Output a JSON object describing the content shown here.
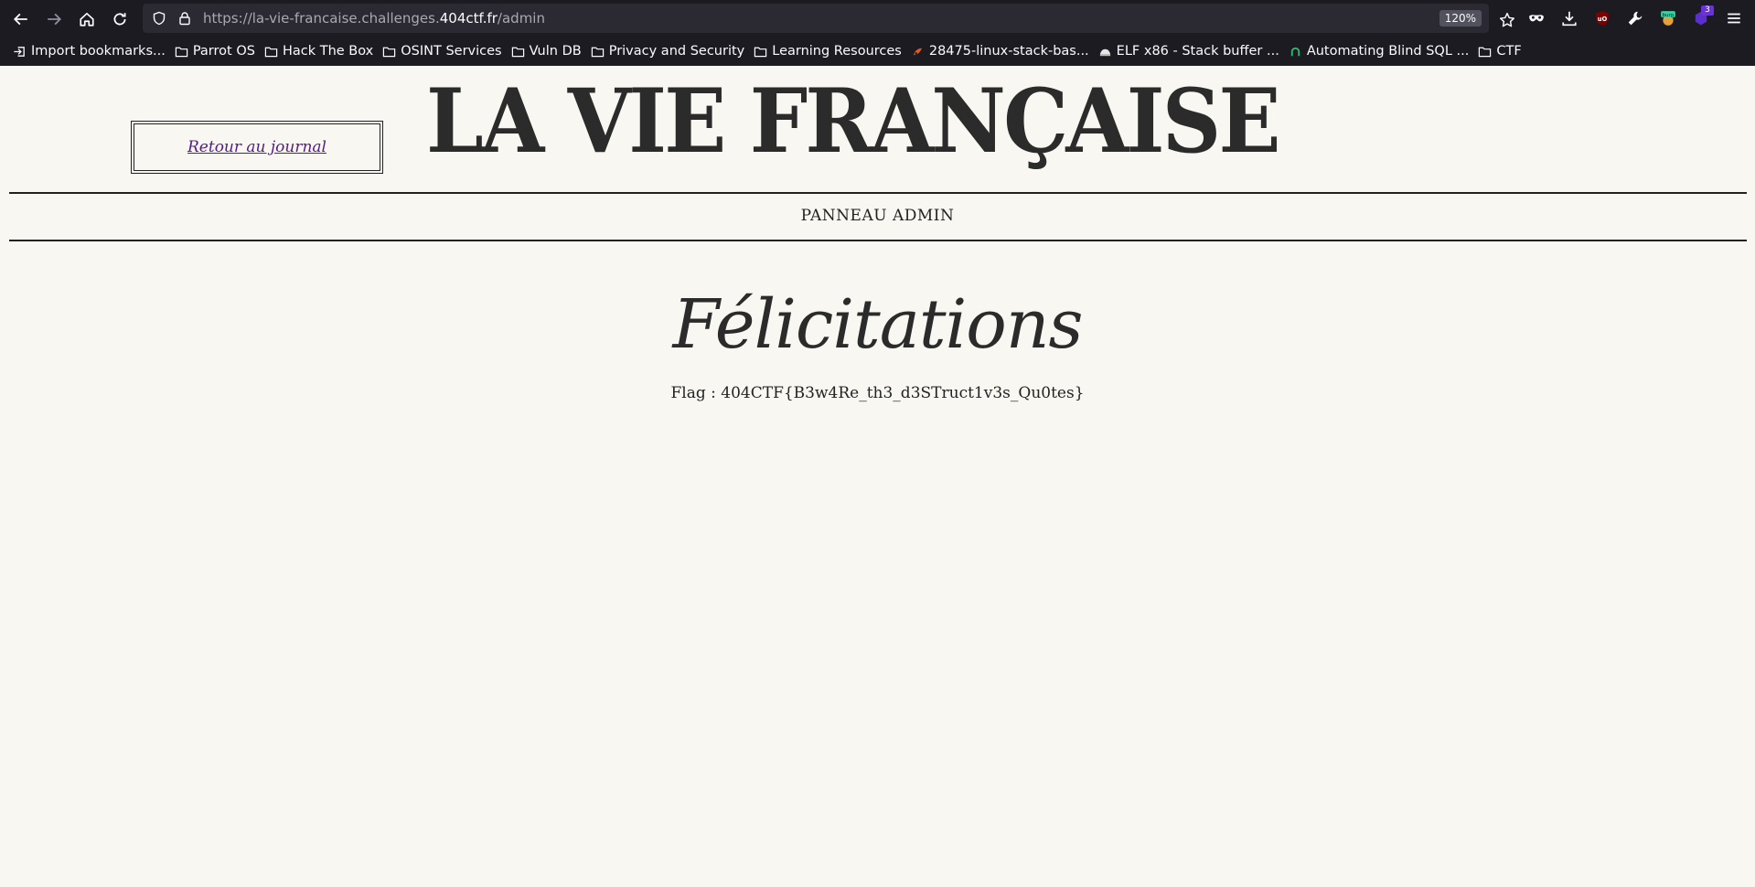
{
  "browser": {
    "url_prefix": "https://la-vie-francaise.challenges.",
    "url_host": "404ctf.fr",
    "url_path": "/admin",
    "zoom": "120%",
    "extension_badge": "3",
    "bookmarks": [
      {
        "label": "Import bookmarks...",
        "icon": "import-icon"
      },
      {
        "label": "Parrot OS",
        "icon": "folder-icon"
      },
      {
        "label": "Hack The Box",
        "icon": "folder-icon"
      },
      {
        "label": "OSINT Services",
        "icon": "folder-icon"
      },
      {
        "label": "Vuln DB",
        "icon": "folder-icon"
      },
      {
        "label": "Privacy and Security",
        "icon": "folder-icon"
      },
      {
        "label": "Learning Resources",
        "icon": "folder-icon"
      },
      {
        "label": "28475-linux-stack-bas...",
        "icon": "exploit-db-icon"
      },
      {
        "label": "ELF x86 - Stack buffer ...",
        "icon": "root-me-icon"
      },
      {
        "label": "Automating Blind SQL ...",
        "icon": "site-icon"
      },
      {
        "label": "CTF",
        "icon": "folder-icon"
      }
    ]
  },
  "page": {
    "back_link": "Retour au journal",
    "masthead": "LA VIE FRANÇAISE",
    "section": "PANNEAU ADMIN",
    "heading": "Félicitations",
    "flag": "Flag : 404CTF{B3w4Re_th3_d3STruct1v3s_Qu0tes}"
  },
  "colors": {
    "page_bg": "#f8f7f2",
    "chrome_bg": "#1c1b22",
    "urlbar_bg": "#2b2a33",
    "link": "#551a8b",
    "ink": "#2b2b2b"
  }
}
